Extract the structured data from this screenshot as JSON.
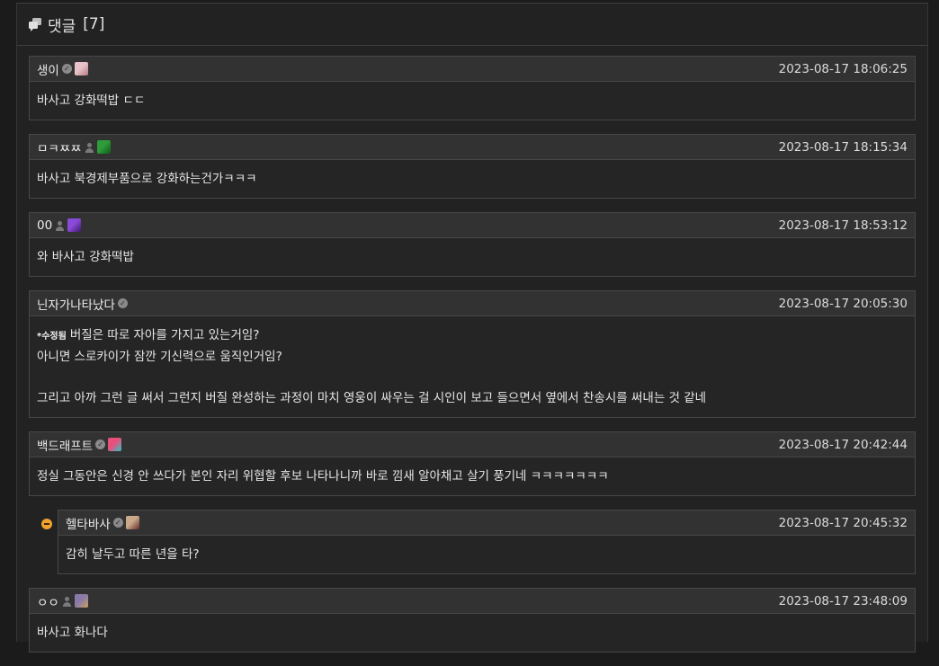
{
  "section": {
    "title": "댓글",
    "count": "[7]",
    "icon": "comments-icon"
  },
  "comments": [
    {
      "author": "생이",
      "badge": "verified",
      "avatar_colors": [
        "#e8c2c8",
        "#b47a86"
      ],
      "timestamp": "2023-08-17 18:06:25",
      "lines": [
        "바사고 강화떡밥 ㄷㄷ"
      ]
    },
    {
      "author": "ㅁㅋㅉㅉ",
      "badge": "member",
      "avatar_colors": [
        "#2e9c3a",
        "#0e5a18"
      ],
      "timestamp": "2023-08-17 18:15:34",
      "lines": [
        "바사고 북경제부품으로 강화하는건가ㅋㅋㅋ"
      ]
    },
    {
      "author": "00",
      "badge": "member",
      "avatar_colors": [
        "#8a4ad8",
        "#3c1a70"
      ],
      "timestamp": "2023-08-17 18:53:12",
      "lines": [
        "와 바사고 강화떡밥"
      ]
    },
    {
      "author": "닌자가나타났다",
      "badge": "verified",
      "avatar_colors": [],
      "timestamp": "2023-08-17 20:05:30",
      "edited_label": "*수정됨",
      "lines": [
        "버질은 따로 자아를 가지고 있는거임?",
        "아니면 스로카이가 잠깐 기신력으로 움직인거임?",
        "",
        "그리고 아까 그런 글 써서 그런지 버질 완성하는 과정이 마치 영웅이 싸우는 걸 시인이 보고 들으면서 옆에서 찬송시를 써내는 것 같네"
      ]
    },
    {
      "author": "백드래프트",
      "badge": "verified",
      "avatar_colors": [
        "#e8507a",
        "#2fc0c8"
      ],
      "timestamp": "2023-08-17 20:42:44",
      "lines": [
        "정실 그동안은 신경 안 쓰다가 본인 자리 위협할 후보 나타나니까 바로 낌새 알아채고 살기 풍기네 ㅋㅋㅋㅋㅋㅋㅋ"
      ]
    },
    {
      "author": "헬타바사",
      "badge": "verified",
      "avatar_colors": [
        "#c9a98a",
        "#6a2a28"
      ],
      "timestamp": "2023-08-17 20:45:32",
      "reply": true,
      "lines": [
        "감히 날두고 따른 년을 타?"
      ]
    },
    {
      "author": "ㅇㅇ",
      "badge": "member",
      "avatar_colors": [
        "#8a7aa8",
        "#c8a060"
      ],
      "timestamp": "2023-08-17 23:48:09",
      "lines": [
        "바사고 화나다"
      ]
    }
  ]
}
